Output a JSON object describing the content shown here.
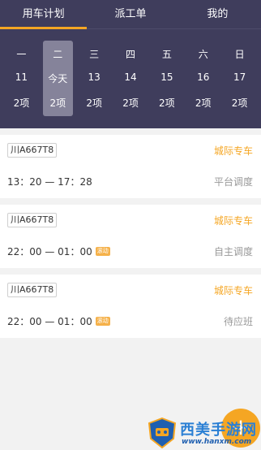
{
  "tabs": [
    "用车计划",
    "派工单",
    "我的"
  ],
  "calendar": [
    {
      "weekday": "一",
      "date": "11",
      "count": "2项"
    },
    {
      "weekday": "二",
      "date": "今天",
      "count": "2项"
    },
    {
      "weekday": "三",
      "date": "13",
      "count": "2项"
    },
    {
      "weekday": "四",
      "date": "14",
      "count": "2项"
    },
    {
      "weekday": "五",
      "date": "15",
      "count": "2项"
    },
    {
      "weekday": "六",
      "date": "16",
      "count": "2项"
    },
    {
      "weekday": "日",
      "date": "17",
      "count": "2项"
    }
  ],
  "trips": [
    {
      "plate": "川A667T8",
      "type": "城际专车",
      "time": "13：20 — 17：28",
      "tag": "",
      "status": "平台调度"
    },
    {
      "plate": "川A667T8",
      "type": "城际专车",
      "time": "22：00 — 01：00",
      "tag": "滚动",
      "status": "自主调度"
    },
    {
      "plate": "川A667T8",
      "type": "城际专车",
      "time": "22：00 — 01：00",
      "tag": "滚动",
      "status": "待应班"
    }
  ],
  "fab": {
    "icon": "plus-icon",
    "label": "+"
  },
  "watermark": {
    "title": "西美手游网",
    "url": "www.hanxm.com"
  },
  "colors": {
    "header_bg": "#3f3d5c",
    "accent": "#f5a623",
    "selected_day_bg": "#85839a"
  }
}
